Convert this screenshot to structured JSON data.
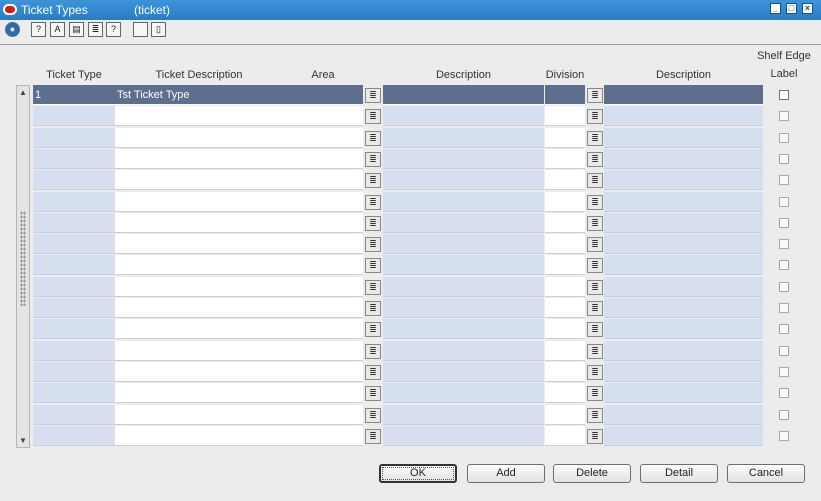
{
  "window": {
    "title": "Ticket Types",
    "subtitle": "(ticket)"
  },
  "toolbar": {
    "icons": [
      "globe-icon",
      "help-icon",
      "spell-icon",
      "save-icon",
      "print-icon",
      "info-icon",
      "blank-icon",
      "document-icon"
    ]
  },
  "table": {
    "headers": {
      "ticket_type": "Ticket Type",
      "ticket_description": "Ticket Description",
      "area": "Area",
      "area_description": "Description",
      "division": "Division",
      "division_description": "Description",
      "shelf_edge_label_line1": "Shelf Edge",
      "shelf_edge_label_line2": "Label"
    },
    "rows": [
      {
        "ticket_type": "1",
        "ticket_description": "Tst Ticket Type",
        "area": "",
        "area_description": "",
        "division": "",
        "division_description": "",
        "shelf_edge_label": false
      },
      {
        "ticket_type": "",
        "ticket_description": "",
        "area": "",
        "area_description": "",
        "division": "",
        "division_description": "",
        "shelf_edge_label": false
      },
      {
        "ticket_type": "",
        "ticket_description": "",
        "area": "",
        "area_description": "",
        "division": "",
        "division_description": "",
        "shelf_edge_label": false
      },
      {
        "ticket_type": "",
        "ticket_description": "",
        "area": "",
        "area_description": "",
        "division": "",
        "division_description": "",
        "shelf_edge_label": false
      },
      {
        "ticket_type": "",
        "ticket_description": "",
        "area": "",
        "area_description": "",
        "division": "",
        "division_description": "",
        "shelf_edge_label": false
      },
      {
        "ticket_type": "",
        "ticket_description": "",
        "area": "",
        "area_description": "",
        "division": "",
        "division_description": "",
        "shelf_edge_label": false
      },
      {
        "ticket_type": "",
        "ticket_description": "",
        "area": "",
        "area_description": "",
        "division": "",
        "division_description": "",
        "shelf_edge_label": false
      },
      {
        "ticket_type": "",
        "ticket_description": "",
        "area": "",
        "area_description": "",
        "division": "",
        "division_description": "",
        "shelf_edge_label": false
      },
      {
        "ticket_type": "",
        "ticket_description": "",
        "area": "",
        "area_description": "",
        "division": "",
        "division_description": "",
        "shelf_edge_label": false
      },
      {
        "ticket_type": "",
        "ticket_description": "",
        "area": "",
        "area_description": "",
        "division": "",
        "division_description": "",
        "shelf_edge_label": false
      },
      {
        "ticket_type": "",
        "ticket_description": "",
        "area": "",
        "area_description": "",
        "division": "",
        "division_description": "",
        "shelf_edge_label": false
      },
      {
        "ticket_type": "",
        "ticket_description": "",
        "area": "",
        "area_description": "",
        "division": "",
        "division_description": "",
        "shelf_edge_label": false
      },
      {
        "ticket_type": "",
        "ticket_description": "",
        "area": "",
        "area_description": "",
        "division": "",
        "division_description": "",
        "shelf_edge_label": false
      },
      {
        "ticket_type": "",
        "ticket_description": "",
        "area": "",
        "area_description": "",
        "division": "",
        "division_description": "",
        "shelf_edge_label": false
      },
      {
        "ticket_type": "",
        "ticket_description": "",
        "area": "",
        "area_description": "",
        "division": "",
        "division_description": "",
        "shelf_edge_label": false
      },
      {
        "ticket_type": "",
        "ticket_description": "",
        "area": "",
        "area_description": "",
        "division": "",
        "division_description": "",
        "shelf_edge_label": false
      },
      {
        "ticket_type": "",
        "ticket_description": "",
        "area": "",
        "area_description": "",
        "division": "",
        "division_description": "",
        "shelf_edge_label": false
      }
    ]
  },
  "buttons": {
    "ok": "OK",
    "add": "Add",
    "delete": "Delete",
    "detail": "Detail",
    "cancel": "Cancel"
  },
  "colors": {
    "titlebar": "#2a7cc4",
    "selected_row": "#5c6f8e",
    "readonly_cell": "#d6dfef"
  }
}
